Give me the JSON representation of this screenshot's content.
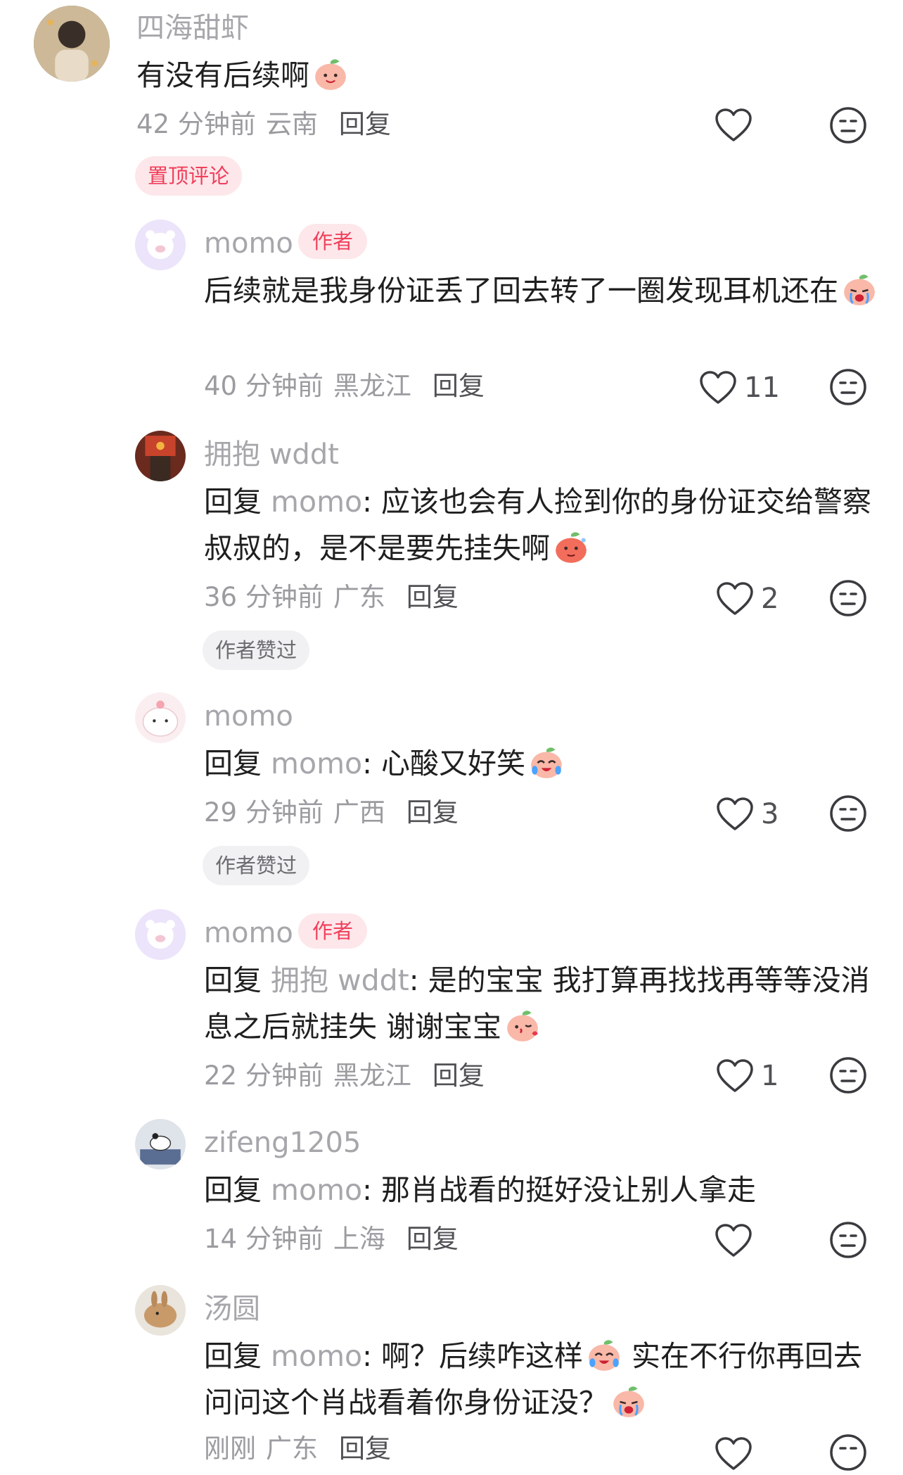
{
  "labels": {
    "reply": "回复",
    "author": "作者",
    "reply_prefix": "回复",
    "colon": ":"
  },
  "colors": {
    "accent": "#f0405c",
    "name_gray": "#a6a6ab"
  },
  "comments": [
    {
      "name": "四海甜虾",
      "text": "有没有后续啊",
      "emoji": "smile-emoji",
      "time": "42 分钟前",
      "location": "云南",
      "likes": "",
      "tag": "置顶评论"
    },
    {
      "name": "momo",
      "author": true,
      "text": "后续就是我身份证丢了回去转了一圈发现耳机还在",
      "emoji": "cry-emoji",
      "time": "40 分钟前",
      "location": "黑龙江",
      "likes": "11"
    },
    {
      "name": "拥抱 wddt",
      "reply_to": "momo",
      "text": "应该也会有人捡到你的身份证交给警察叔叔的，是不是要先挂失啊",
      "emoji": "hot-emoji",
      "time": "36 分钟前",
      "location": "广东",
      "likes": "2",
      "tag": "作者赞过"
    },
    {
      "name": "momo",
      "reply_to": "momo",
      "text": "心酸又好笑",
      "emoji": "laugh-cry-emoji",
      "time": "29 分钟前",
      "location": "广西",
      "likes": "3",
      "tag": "作者赞过"
    },
    {
      "name": "momo",
      "author": true,
      "reply_to": "拥抱 wddt",
      "text": "是的宝宝 我打算再找找再等等没消息之后就挂失 谢谢宝宝",
      "emoji": "kiss-emoji",
      "time": "22 分钟前",
      "location": "黑龙江",
      "likes": "1"
    },
    {
      "name": "zifeng1205",
      "reply_to": "momo",
      "text": "那肖战看的挺好没让别人拿走",
      "time": "14 分钟前",
      "location": "上海",
      "likes": ""
    },
    {
      "name": "汤圆",
      "reply_to": "momo",
      "text": "啊？后续咋这样",
      "emoji": "laugh-cry-emoji",
      "text2": " 实在不行你再回去问问这个肖战看着你身份证没？",
      "emoji2": "cry-emoji",
      "time": "刚刚",
      "location": "广东",
      "likes": ""
    }
  ]
}
